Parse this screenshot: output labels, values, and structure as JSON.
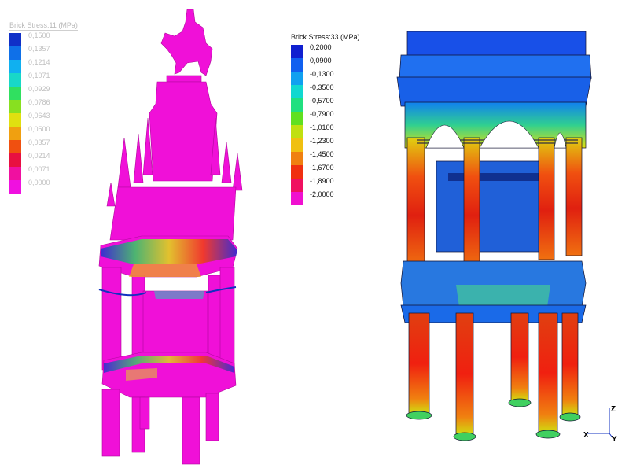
{
  "left_panel": {
    "legend": {
      "title": "Brick Stress:11 (MPa)",
      "labels": [
        "0,1500",
        "0,1357",
        "0,1214",
        "0,1071",
        "0,0929",
        "0,0786",
        "0,0643",
        "0,0500",
        "0,0357",
        "0,0214",
        "0,0071",
        "0,0000"
      ],
      "colors": [
        "#1030c8",
        "#0f70e8",
        "#10b0f0",
        "#18d8c8",
        "#30e060",
        "#88e020",
        "#e0e010",
        "#f0a010",
        "#f05010",
        "#e81040",
        "#f010a0",
        "#f010e0"
      ]
    },
    "model_color": "#f010d8"
  },
  "right_panel": {
    "legend": {
      "title": "Brick Stress:33 (MPa)",
      "labels": [
        "0,2000",
        "0,0900",
        "-0,1300",
        "-0,3500",
        "-0,5700",
        "-0,7900",
        "-1,0100",
        "-1,2300",
        "-1,4500",
        "-1,6700",
        "-1,8900",
        "-2,0000"
      ],
      "colors": [
        "#1020d0",
        "#1060f0",
        "#10a0f0",
        "#10d8d0",
        "#20e080",
        "#60e020",
        "#c0e010",
        "#f0c010",
        "#f08010",
        "#f03010",
        "#f01060",
        "#f010d0"
      ]
    },
    "axes": {
      "z": "Z",
      "x": "X",
      "y": "Y"
    }
  }
}
